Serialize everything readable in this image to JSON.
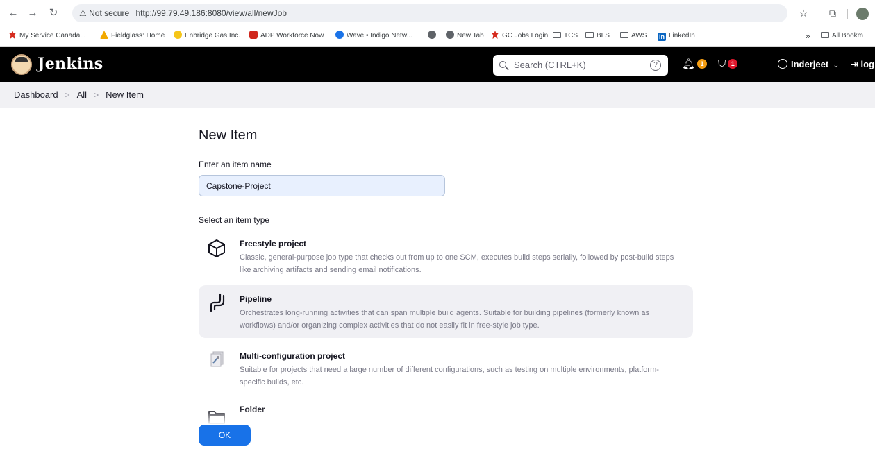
{
  "browser": {
    "security_label": "Not secure",
    "url": "http://99.79.49.186:8080/view/all/newJob",
    "bookmarks": [
      {
        "label": "My Service Canada...",
        "icon": "maple-leaf-icon"
      },
      {
        "label": "Fieldglass: Home",
        "icon": "fieldglass-icon"
      },
      {
        "label": "Enbridge Gas Inc.",
        "icon": "enbridge-icon"
      },
      {
        "label": "ADP Workforce Now",
        "icon": "adp-icon"
      },
      {
        "label": "Wave • Indigo Netw...",
        "icon": "wave-icon"
      },
      {
        "label": "",
        "icon": "globe-icon"
      },
      {
        "label": "New Tab",
        "icon": "globe-icon"
      },
      {
        "label": "GC Jobs Login",
        "icon": "maple-leaf-icon"
      },
      {
        "label": "TCS",
        "icon": "folder-icon"
      },
      {
        "label": "BLS",
        "icon": "folder-icon"
      },
      {
        "label": "AWS",
        "icon": "folder-icon"
      },
      {
        "label": "LinkedIn",
        "icon": "linkedin-icon"
      }
    ],
    "overflow_label": "»",
    "all_bookmarks_label": "All Bookm"
  },
  "header": {
    "title": "Jenkins",
    "search_placeholder": "Search (CTRL+K)",
    "help_glyph": "?",
    "notifications_count": "1",
    "security_count": "1",
    "user_name": "Inderjeet",
    "logout_label": "log out"
  },
  "breadcrumb": [
    "Dashboard",
    "All",
    "New Item"
  ],
  "form": {
    "title": "New Item",
    "name_label": "Enter an item name",
    "name_value": "Capstone-Project",
    "type_label": "Select an item type",
    "ok_label": "OK"
  },
  "item_types": [
    {
      "name": "Freestyle project",
      "desc": "Classic, general-purpose job type that checks out from up to one SCM, executes build steps serially, followed by post-build steps like archiving artifacts and sending email notifications.",
      "icon": "cube-icon",
      "selected": false
    },
    {
      "name": "Pipeline",
      "desc": "Orchestrates long-running activities that can span multiple build agents. Suitable for building pipelines (formerly known as workflows) and/or organizing complex activities that do not easily fit in free-style job type.",
      "icon": "pipeline-icon",
      "selected": true
    },
    {
      "name": "Multi-configuration project",
      "desc": "Suitable for projects that need a large number of different configurations, such as testing on multiple environments, platform-specific builds, etc.",
      "icon": "multi-config-icon",
      "selected": false
    },
    {
      "name": "Folder",
      "desc": "",
      "icon": "folder-icon",
      "selected": false
    }
  ],
  "colors": {
    "header_bg": "#000000",
    "primary_button": "#1872e8",
    "badge_orange": "#f39c12",
    "badge_red": "#e0182d"
  }
}
